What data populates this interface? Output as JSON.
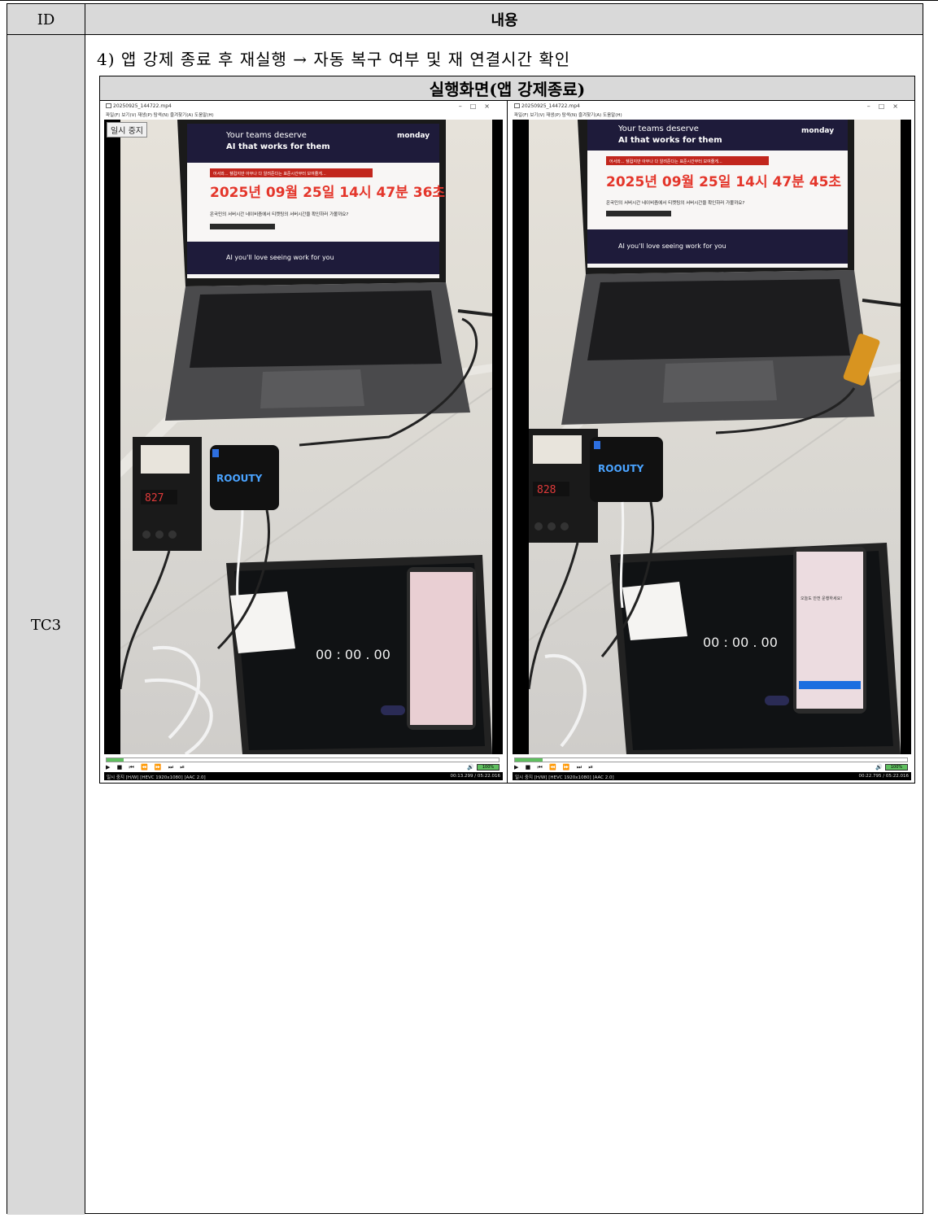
{
  "table": {
    "header_id": "ID",
    "header_content": "내용",
    "row_id": "TC3",
    "step": "4) 앱 강제 종료 후 재실행 → 자동 복구 여부 및 재 연결시간 확인",
    "section_title": "실행화면(앱 강제종료)"
  },
  "players": [
    {
      "window_title": "20250925_144722.mp4",
      "menu": "파일(F)  보기(V)  재생(P)  탐색(N)  즐겨찾기(A)  도움말(H)",
      "overlay": "일시 중지",
      "screen_line1": "Your teams deserve",
      "screen_line2": "AI that works for them",
      "screen_banner": "어서와... 쉘컵지만 아무나 다 알려준다는 표준시간부터 보여줄게...",
      "screen_time": "2025년 09월 25일 14시 47분 36초",
      "screen_question": "온국민의 서버시간 네이비즘에서 티켓팅의 서버시간을 확인하러 가볼까요?",
      "screen_ad": "AI you'll love seeing work for you",
      "logo": "monday",
      "device_label": "ROOUTY",
      "tablet_timer": "00 : 00 . 00",
      "progress": 0.043,
      "volume": "100%",
      "status_left": "일시 중지 [H/W] [HEVC 1920x1080] [AAC 2.0]",
      "status_right": "00:13.299 / 05:22.016"
    },
    {
      "window_title": "20250925_144722.mp4",
      "menu": "파일(F)  보기(V)  재생(P)  탐색(N)  즐겨찾기(A)  도움말(H)",
      "overlay": "",
      "screen_line1": "Your teams deserve",
      "screen_line2": "AI that works for them",
      "screen_banner": "어서와... 쉘컵지만 아무나 다 알려준다는 표준시간부터 보여줄게...",
      "screen_time": "2025년 09월 25일 14시 47분 45초",
      "screen_question": "온국민의 서버시간 네이비즘에서 티켓팅의 서버시간을 확인하러 가볼까요?",
      "screen_ad": "AI you'll love seeing work for you",
      "logo": "monday",
      "device_label": "ROOUTY",
      "tablet_timer": "00 : 00 . 00",
      "phone_text": "오늘도 안전 운행하세요!",
      "progress": 0.071,
      "volume": "100%",
      "status_left": "일시 중지 [H/W] [HEVC 1920x1080] [AAC 2.0]",
      "status_right": "00:22.795 / 05:22.016"
    }
  ]
}
